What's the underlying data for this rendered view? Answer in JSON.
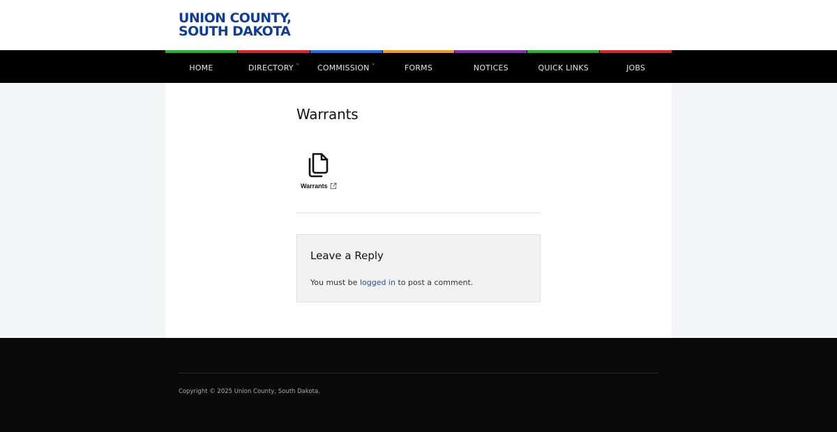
{
  "site": {
    "title_line1": "UNION COUNTY,",
    "title_line2": "SOUTH DAKOTA"
  },
  "nav": {
    "items": [
      {
        "label": "HOME",
        "has_dropdown": false,
        "accent": "#1fb52b"
      },
      {
        "label": "DIRECTORY",
        "has_dropdown": true,
        "accent": "#e0222b"
      },
      {
        "label": "COMMISSION",
        "has_dropdown": true,
        "accent": "#1f6fe6"
      },
      {
        "label": "FORMS",
        "has_dropdown": false,
        "accent": "#f39a1e"
      },
      {
        "label": "NOTICES",
        "has_dropdown": false,
        "accent": "#8a2fc4"
      },
      {
        "label": "QUICK LINKS",
        "has_dropdown": false,
        "accent": "#1fb52b"
      },
      {
        "label": "JOBS",
        "has_dropdown": false,
        "accent": "#e0222b"
      }
    ],
    "caret": "˅"
  },
  "page": {
    "title": "Warrants"
  },
  "file": {
    "label": "Warrants",
    "icon": "file-copy-icon",
    "link_icon": "external-link-icon"
  },
  "reply": {
    "title": "Leave a Reply",
    "text_before": "You must be ",
    "link_text": "logged in",
    "text_after": " to post a comment."
  },
  "footer": {
    "copyright": "Copyright © 2025 Union County, South Dakota."
  },
  "colors": {
    "brand": "#103c9a",
    "link": "#1f4fa6"
  }
}
